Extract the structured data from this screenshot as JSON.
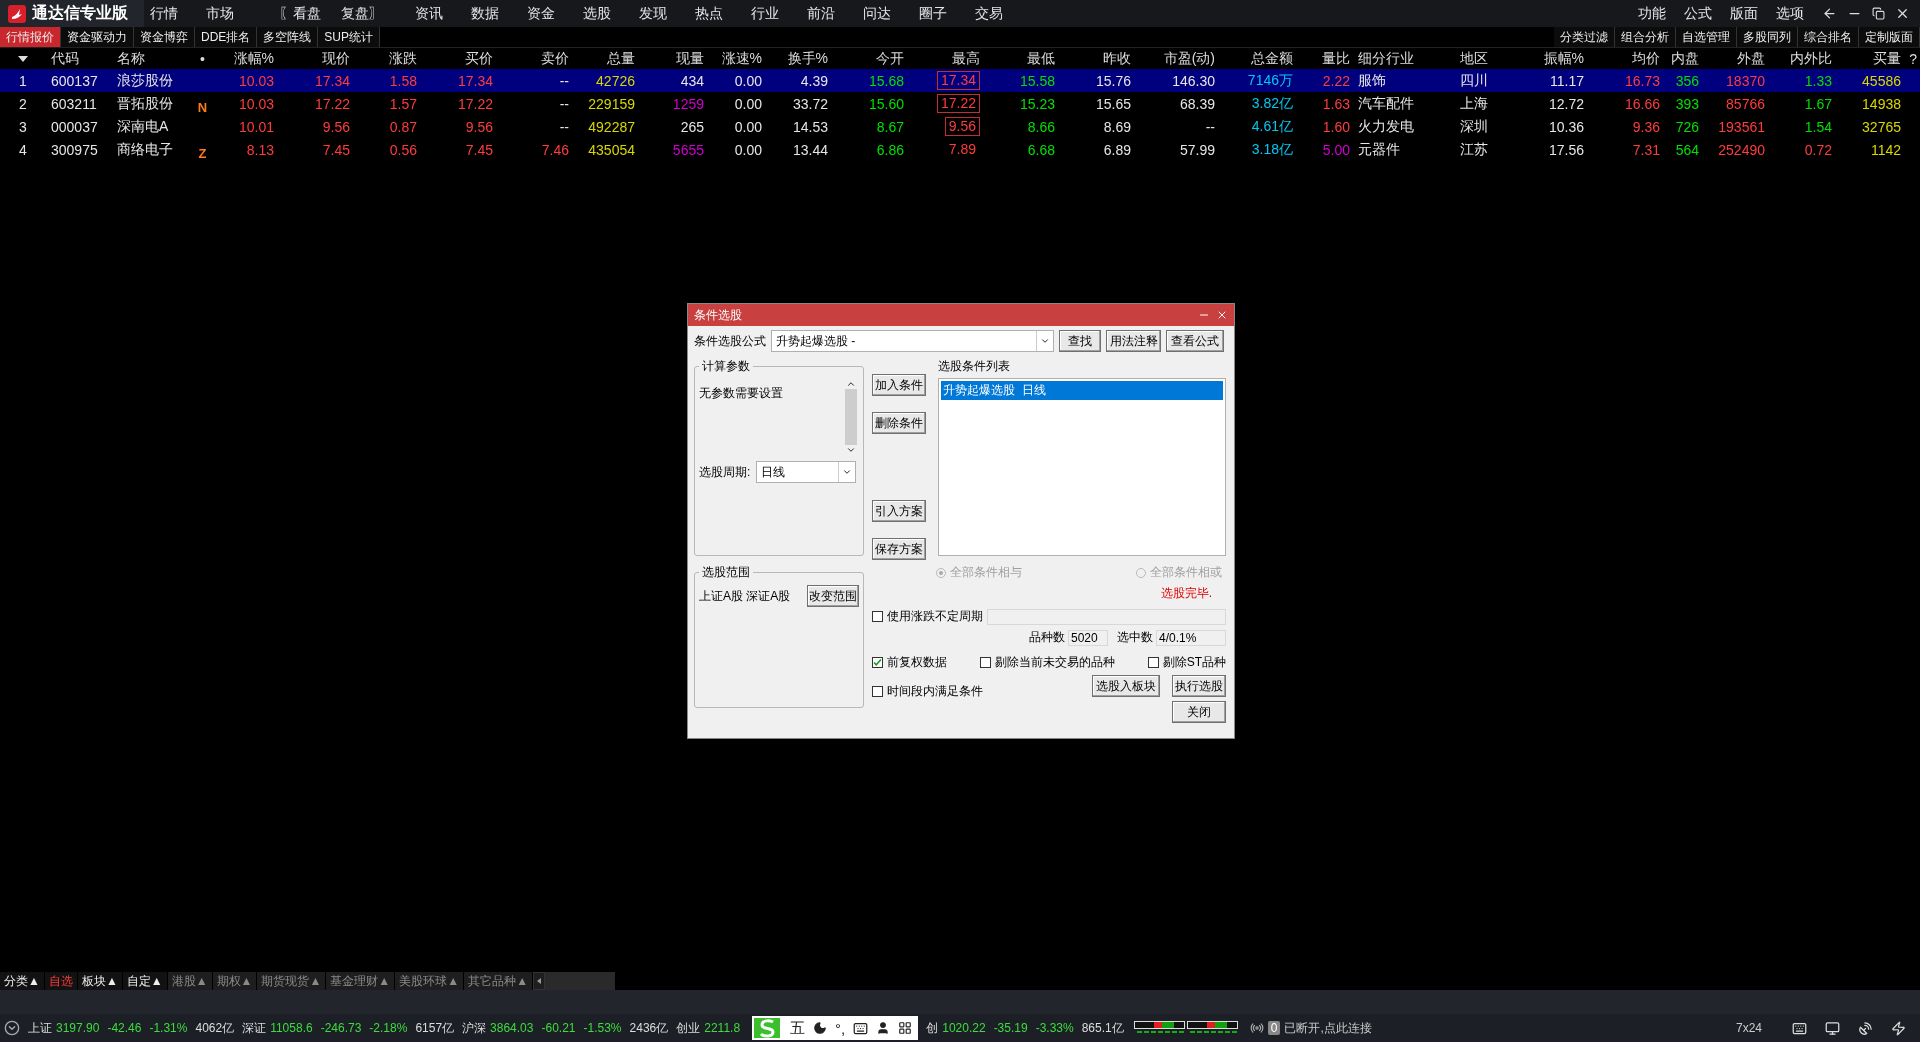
{
  "app": {
    "title": "通达信专业版"
  },
  "menu": [
    "行情",
    "市场",
    "〖看盘",
    "复盘〗",
    "资讯",
    "数据",
    "资金",
    "选股",
    "发现",
    "热点",
    "行业",
    "前沿",
    "问达",
    "圈子",
    "交易"
  ],
  "menu_right": [
    "功能",
    "公式",
    "版面",
    "选项"
  ],
  "tabs": [
    {
      "label": "行情报价",
      "selected": true
    },
    {
      "label": "资金驱动力",
      "selected": false
    },
    {
      "label": "资金博弈",
      "selected": false
    },
    {
      "label": "DDE排名",
      "selected": false
    },
    {
      "label": "多空阵线",
      "selected": false
    },
    {
      "label": "SUP统计",
      "selected": false
    }
  ],
  "tools": [
    "分类过滤",
    "组合分析",
    "自选管理",
    "多股同列",
    "综合排名",
    "定制版面"
  ],
  "table": {
    "columns": [
      "代码",
      "名称",
      "•",
      "涨幅%",
      "现价",
      "涨跌",
      "买价",
      "卖价",
      "总量",
      "现量",
      "涨速%",
      "换手%",
      "今开",
      "最高",
      "最低",
      "昨收",
      "市盈(动)",
      "总金额",
      "量比",
      "细分行业",
      "地区",
      "振幅%",
      "均价",
      "内盘",
      "外盘",
      "内外比",
      "买量",
      "?"
    ],
    "rows": [
      {
        "index": "1",
        "selected": true,
        "high_boxed": true,
        "cells": [
          {
            "text": "600137",
            "color": "#e6e6e6"
          },
          {
            "text": "浪莎股份",
            "color": "#e6e6e6"
          },
          {
            "text": ""
          },
          {
            "text": "10.03",
            "color": "#ff3c3c"
          },
          {
            "text": "17.34",
            "color": "#ff3c3c"
          },
          {
            "text": "1.58",
            "color": "#ff3c3c"
          },
          {
            "text": "17.34",
            "color": "#ff3c3c"
          },
          {
            "text": "--",
            "color": "#e6e6e6"
          },
          {
            "text": "42726",
            "color": "#d8d800"
          },
          {
            "text": "434",
            "color": "#e6e6e6"
          },
          {
            "text": "0.00",
            "color": "#e6e6e6"
          },
          {
            "text": "4.39",
            "color": "#e6e6e6"
          },
          {
            "text": "15.68",
            "color": "#00e000"
          },
          {
            "text": "17.34",
            "color": "#ff3c3c"
          },
          {
            "text": "15.58",
            "color": "#00e000"
          },
          {
            "text": "15.76",
            "color": "#e6e6e6"
          },
          {
            "text": "146.30",
            "color": "#e6e6e6"
          },
          {
            "text": "7146万",
            "color": "#00c8f0"
          },
          {
            "text": "2.22",
            "color": "#ff3c3c"
          },
          {
            "text": "服饰",
            "color": "#e6e6e6"
          },
          {
            "text": "四川",
            "color": "#e6e6e6"
          },
          {
            "text": "11.17",
            "color": "#e6e6e6"
          },
          {
            "text": "16.73",
            "color": "#ff3c3c"
          },
          {
            "text": "356",
            "color": "#00e000"
          },
          {
            "text": "18370",
            "color": "#ff3c3c"
          },
          {
            "text": "1.33",
            "color": "#00e000"
          },
          {
            "text": "45586",
            "color": "#d8d800"
          }
        ]
      },
      {
        "index": "2",
        "selected": false,
        "high_boxed": true,
        "cells": [
          {
            "text": "603211",
            "color": "#e6e6e6"
          },
          {
            "text": "晋拓股份",
            "color": "#e6e6e6"
          },
          {
            "text": "N",
            "color": "#ff7a1a"
          },
          {
            "text": "10.03",
            "color": "#ff3c3c"
          },
          {
            "text": "17.22",
            "color": "#ff3c3c"
          },
          {
            "text": "1.57",
            "color": "#ff3c3c"
          },
          {
            "text": "17.22",
            "color": "#ff3c3c"
          },
          {
            "text": "--",
            "color": "#e6e6e6"
          },
          {
            "text": "229159",
            "color": "#d8d800"
          },
          {
            "text": "1259",
            "color": "#d000d0"
          },
          {
            "text": "0.00",
            "color": "#e6e6e6"
          },
          {
            "text": "33.72",
            "color": "#e6e6e6"
          },
          {
            "text": "15.60",
            "color": "#00e000"
          },
          {
            "text": "17.22",
            "color": "#ff3c3c"
          },
          {
            "text": "15.23",
            "color": "#00e000"
          },
          {
            "text": "15.65",
            "color": "#e6e6e6"
          },
          {
            "text": "68.39",
            "color": "#e6e6e6"
          },
          {
            "text": "3.82亿",
            "color": "#00c8f0"
          },
          {
            "text": "1.63",
            "color": "#ff3c3c"
          },
          {
            "text": "汽车配件",
            "color": "#e6e6e6"
          },
          {
            "text": "上海",
            "color": "#e6e6e6"
          },
          {
            "text": "12.72",
            "color": "#e6e6e6"
          },
          {
            "text": "16.66",
            "color": "#ff3c3c"
          },
          {
            "text": "393",
            "color": "#00e000"
          },
          {
            "text": "85766",
            "color": "#ff3c3c"
          },
          {
            "text": "1.67",
            "color": "#00e000"
          },
          {
            "text": "14938",
            "color": "#d8d800"
          }
        ]
      },
      {
        "index": "3",
        "selected": false,
        "high_boxed": true,
        "cells": [
          {
            "text": "000037",
            "color": "#e6e6e6"
          },
          {
            "text": "深南电A",
            "color": "#e6e6e6"
          },
          {
            "text": ""
          },
          {
            "text": "10.01",
            "color": "#ff3c3c"
          },
          {
            "text": "9.56",
            "color": "#ff3c3c"
          },
          {
            "text": "0.87",
            "color": "#ff3c3c"
          },
          {
            "text": "9.56",
            "color": "#ff3c3c"
          },
          {
            "text": "--",
            "color": "#e6e6e6"
          },
          {
            "text": "492287",
            "color": "#d8d800"
          },
          {
            "text": "265",
            "color": "#e6e6e6"
          },
          {
            "text": "0.00",
            "color": "#e6e6e6"
          },
          {
            "text": "14.53",
            "color": "#e6e6e6"
          },
          {
            "text": "8.67",
            "color": "#00e000"
          },
          {
            "text": "9.56",
            "color": "#ff3c3c"
          },
          {
            "text": "8.66",
            "color": "#00e000"
          },
          {
            "text": "8.69",
            "color": "#e6e6e6"
          },
          {
            "text": "--",
            "color": "#e6e6e6"
          },
          {
            "text": "4.61亿",
            "color": "#00c8f0"
          },
          {
            "text": "1.60",
            "color": "#ff3c3c"
          },
          {
            "text": "火力发电",
            "color": "#e6e6e6"
          },
          {
            "text": "深圳",
            "color": "#e6e6e6"
          },
          {
            "text": "10.36",
            "color": "#e6e6e6"
          },
          {
            "text": "9.36",
            "color": "#ff3c3c"
          },
          {
            "text": "726",
            "color": "#00e000"
          },
          {
            "text": "193561",
            "color": "#ff3c3c"
          },
          {
            "text": "1.54",
            "color": "#00e000"
          },
          {
            "text": "32765",
            "color": "#d8d800"
          }
        ]
      },
      {
        "index": "4",
        "selected": false,
        "high_boxed": false,
        "cells": [
          {
            "text": "300975",
            "color": "#e6e6e6"
          },
          {
            "text": "商络电子",
            "color": "#e6e6e6"
          },
          {
            "text": "Z",
            "color": "#ff7a1a"
          },
          {
            "text": "8.13",
            "color": "#ff3c3c"
          },
          {
            "text": "7.45",
            "color": "#ff3c3c"
          },
          {
            "text": "0.56",
            "color": "#ff3c3c"
          },
          {
            "text": "7.45",
            "color": "#ff3c3c"
          },
          {
            "text": "7.46",
            "color": "#ff3c3c"
          },
          {
            "text": "435054",
            "color": "#d8d800"
          },
          {
            "text": "5655",
            "color": "#d000d0"
          },
          {
            "text": "0.00",
            "color": "#e6e6e6"
          },
          {
            "text": "13.44",
            "color": "#e6e6e6"
          },
          {
            "text": "6.86",
            "color": "#00e000"
          },
          {
            "text": "7.89",
            "color": "#ff3c3c"
          },
          {
            "text": "6.68",
            "color": "#00e000"
          },
          {
            "text": "6.89",
            "color": "#e6e6e6"
          },
          {
            "text": "57.99",
            "color": "#e6e6e6"
          },
          {
            "text": "3.18亿",
            "color": "#00c8f0"
          },
          {
            "text": "5.00",
            "color": "#d000d0"
          },
          {
            "text": "元器件",
            "color": "#e6e6e6"
          },
          {
            "text": "江苏",
            "color": "#e6e6e6"
          },
          {
            "text": "17.56",
            "color": "#e6e6e6"
          },
          {
            "text": "7.31",
            "color": "#ff3c3c"
          },
          {
            "text": "564",
            "color": "#00e000"
          },
          {
            "text": "252490",
            "color": "#ff3c3c"
          },
          {
            "text": "0.72",
            "color": "#ff3c3c"
          },
          {
            "text": "1142",
            "color": "#d8d800"
          }
        ]
      }
    ]
  },
  "dialog": {
    "title": "条件选股",
    "formula": {
      "label": "条件选股公式",
      "value": "升势起爆选股 -"
    },
    "top_buttons": [
      "查找",
      "用法注释",
      "查看公式"
    ],
    "calc_group": {
      "title": "计算参数",
      "text": "无参数需要设置"
    },
    "period": {
      "label": "选股周期:",
      "value": "日线"
    },
    "range_group": {
      "title": "选股范围",
      "text": "上证A股 深证A股",
      "button": "改变范围"
    },
    "side_buttons": [
      "加入条件",
      "删除条件",
      "引入方案",
      "保存方案"
    ],
    "condition_list": {
      "label": "选股条件列表",
      "items": [
        {
          "text": "升势起爆选股  日线",
          "selected": true
        }
      ]
    },
    "radios": [
      {
        "label": "全部条件相与",
        "selected": true,
        "disabled": true
      },
      {
        "label": "全部条件相或",
        "selected": false,
        "disabled": true
      }
    ],
    "status_text": "选股完毕.",
    "variable_period": {
      "label": "使用涨跌不定周期",
      "checked": false
    },
    "counts": [
      {
        "label": "品种数",
        "value": "5020"
      },
      {
        "label": "选中数",
        "value": "4/0.1%"
      }
    ],
    "options": [
      {
        "label": "前复权数据",
        "checked": true
      },
      {
        "label": "剔除当前未交易的品种",
        "checked": false
      },
      {
        "label": "剔除ST品种",
        "checked": false
      }
    ],
    "time_condition": {
      "label": "时间段内满足条件",
      "checked": false
    },
    "action_buttons": [
      "选股入板块",
      "执行选股"
    ],
    "close_button": "关闭"
  },
  "bottom_tabs": [
    {
      "label": "分类▲",
      "selected": false,
      "dim": false
    },
    {
      "label": "自选",
      "selected": true,
      "dim": false
    },
    {
      "label": "板块▲",
      "selected": false,
      "dim": false
    },
    {
      "label": "自定▲",
      "selected": false,
      "dim": false
    },
    {
      "label": "港股▲",
      "selected": false,
      "dim": true
    },
    {
      "label": "期权▲",
      "selected": false,
      "dim": true
    },
    {
      "label": "期货现货▲",
      "selected": false,
      "dim": true
    },
    {
      "label": "基金理财▲",
      "selected": false,
      "dim": true
    },
    {
      "label": "美股环球▲",
      "selected": false,
      "dim": true
    },
    {
      "label": "其它品种▲",
      "selected": false,
      "dim": true
    }
  ],
  "indices": [
    {
      "name": "上证",
      "values": [
        "3197.90",
        "-42.46",
        "-1.31%"
      ],
      "amount": "4062亿"
    },
    {
      "name": "深证",
      "values": [
        "11058.6",
        "-246.73",
        "-2.18%"
      ],
      "amount": "6157亿"
    },
    {
      "name": "沪深",
      "values": [
        "3864.03",
        "-60.21",
        "-1.53%"
      ],
      "amount": "2436亿"
    },
    {
      "name": "创业",
      "values": [
        "2211.8"
      ]
    },
    {
      "name": "创",
      "values": [
        "1020.22",
        "-35.19",
        "-3.33%"
      ],
      "amount": "865.1亿"
    }
  ],
  "ime": {
    "mode": "五",
    "punct": "°,"
  },
  "connection": {
    "badge": "0",
    "text": "已断开,点此连接"
  },
  "service": "7x24"
}
